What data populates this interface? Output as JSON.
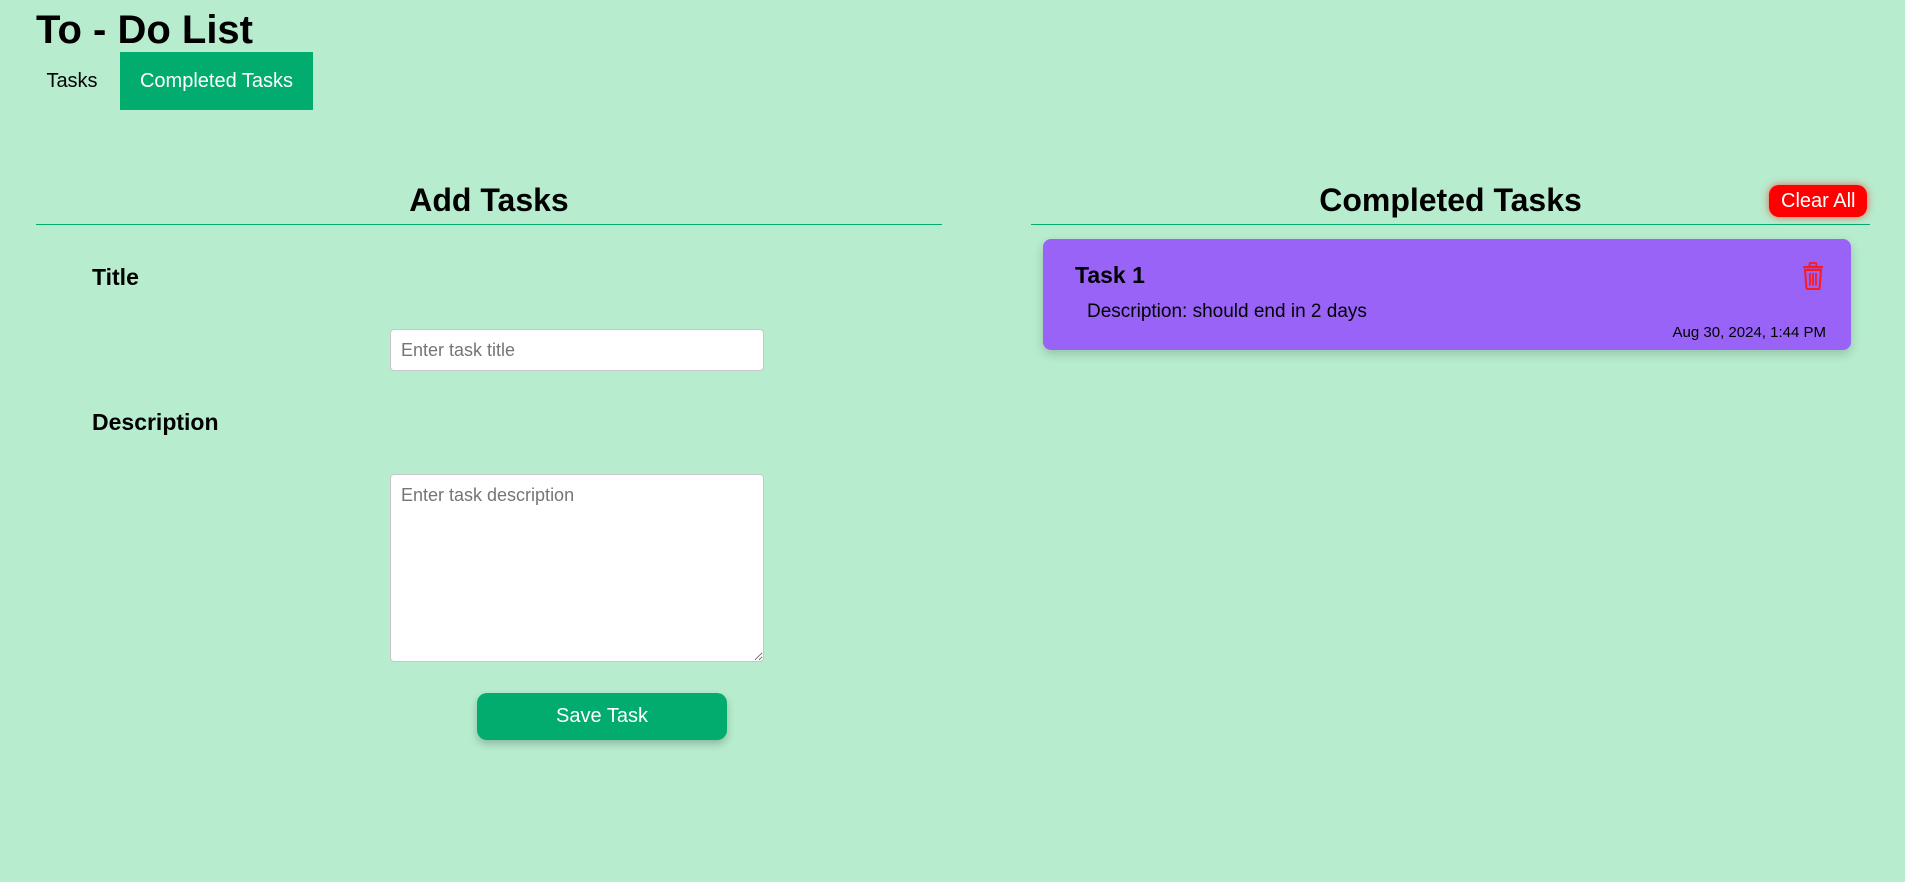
{
  "app": {
    "title": "To - Do List"
  },
  "tabs": [
    {
      "label": "Tasks",
      "active": false
    },
    {
      "label": "Completed Tasks",
      "active": true
    }
  ],
  "add_tasks": {
    "heading": "Add Tasks",
    "title_label": "Title",
    "title_placeholder": "Enter task title",
    "title_value": "",
    "description_label": "Description",
    "description_placeholder": "Enter task description",
    "description_value": "",
    "save_label": "Save Task"
  },
  "completed_tasks": {
    "heading": "Completed Tasks",
    "clear_all_label": "Clear All",
    "items": [
      {
        "title": "Task 1",
        "description": "Description: should end in 2 days",
        "completed_at": "Aug 30, 2024, 1:44 PM",
        "icon": "trash-icon"
      }
    ]
  },
  "colors": {
    "background": "#b7ecce",
    "accent": "#02ab6e",
    "card": "#9863f6",
    "danger": "#ff0000"
  }
}
